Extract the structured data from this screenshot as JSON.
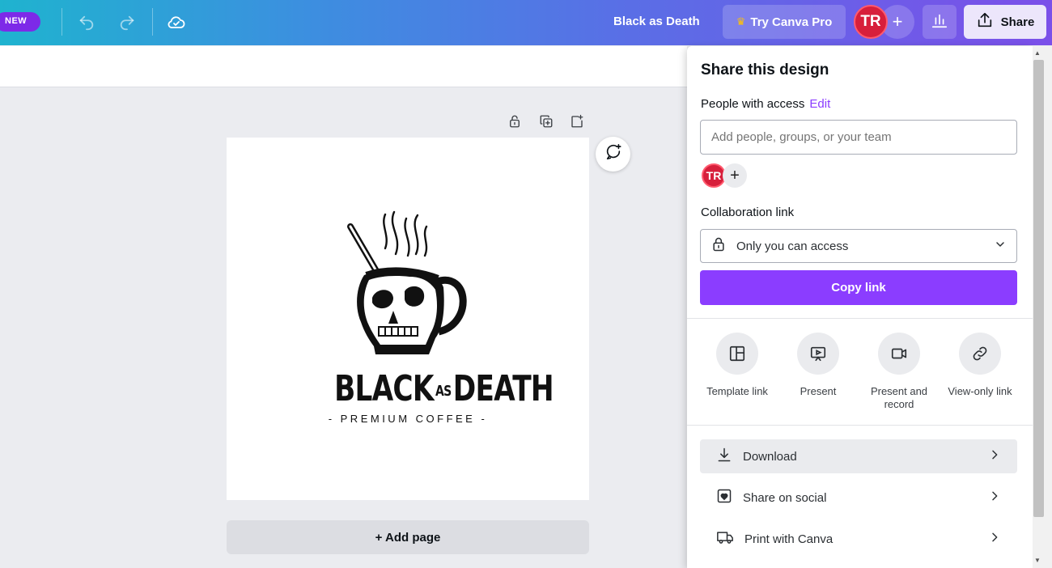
{
  "topbar": {
    "new_badge": "NEW",
    "design_title": "Black as Death",
    "try_pro_label": "Try Canva Pro",
    "user_initials": "TR",
    "share_label": "Share"
  },
  "canvas": {
    "brand_name_part1": "BLACK",
    "brand_name_mid": "AS",
    "brand_name_part2": "DEATH",
    "tagline": "- PREMIUM COFFEE -",
    "add_page_label": "+ Add page"
  },
  "share_panel": {
    "title": "Share this design",
    "people_label": "People with access",
    "edit_label": "Edit",
    "add_people_placeholder": "Add people, groups, or your team",
    "member_initials": "TR",
    "collab_label": "Collaboration link",
    "access_value": "Only you can access",
    "copy_link_label": "Copy link",
    "options": [
      {
        "label": "Template link",
        "icon": "template-icon"
      },
      {
        "label": "Present",
        "icon": "present-icon"
      },
      {
        "label": "Present and record",
        "icon": "record-icon"
      },
      {
        "label": "View-only link",
        "icon": "link-icon"
      }
    ],
    "rows": [
      {
        "label": "Download",
        "icon": "download-icon"
      },
      {
        "label": "Share on social",
        "icon": "heart-icon"
      },
      {
        "label": "Print with Canva",
        "icon": "truck-icon"
      }
    ]
  },
  "colors": {
    "accent": "#8b3dff",
    "avatar": "#d71f3b"
  }
}
